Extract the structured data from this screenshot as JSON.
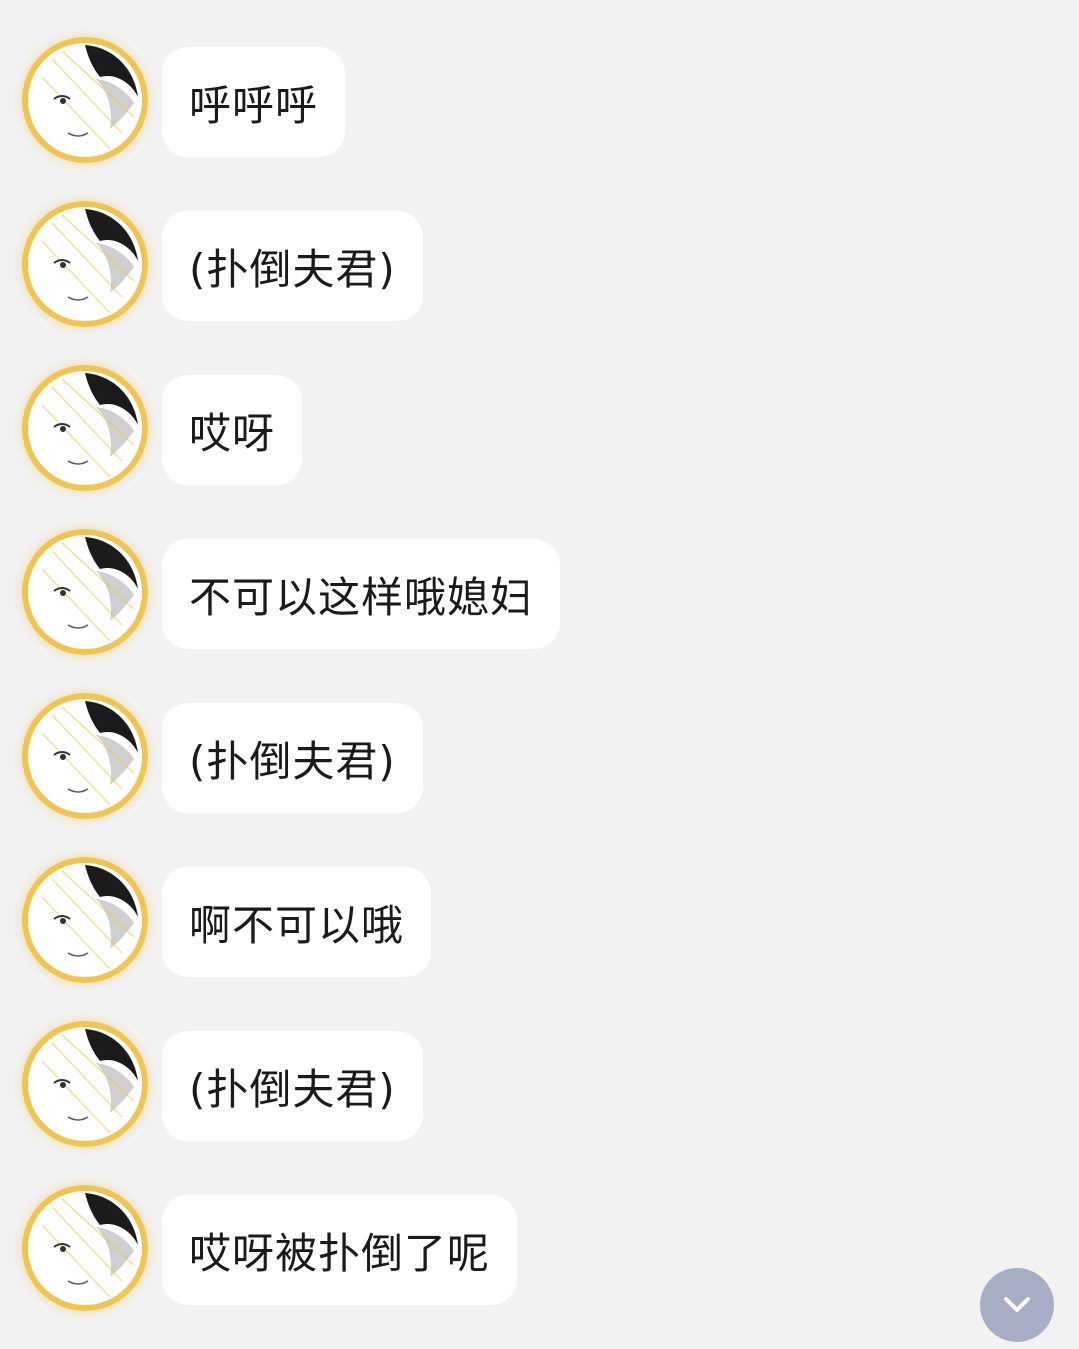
{
  "messages": [
    {
      "text": "呼呼呼",
      "avatar": "anime-character-avatar"
    },
    {
      "text": "(扑倒夫君)",
      "avatar": "anime-character-avatar"
    },
    {
      "text": "哎呀",
      "avatar": "anime-character-avatar"
    },
    {
      "text": "不可以这样哦媳妇",
      "avatar": "anime-character-avatar"
    },
    {
      "text": "(扑倒夫君)",
      "avatar": "anime-character-avatar"
    },
    {
      "text": "啊不可以哦",
      "avatar": "anime-character-avatar"
    },
    {
      "text": "(扑倒夫君)",
      "avatar": "anime-character-avatar"
    },
    {
      "text": "哎呀被扑倒了呢",
      "avatar": "anime-character-avatar"
    }
  ],
  "scroll_button": {
    "icon": "chevron-down-icon"
  },
  "colors": {
    "background": "#f2f2f2",
    "bubble": "#ffffff",
    "text": "#1a1a1a",
    "avatar_ring": "#f0c450",
    "scroll_button": "#a7adc5"
  }
}
